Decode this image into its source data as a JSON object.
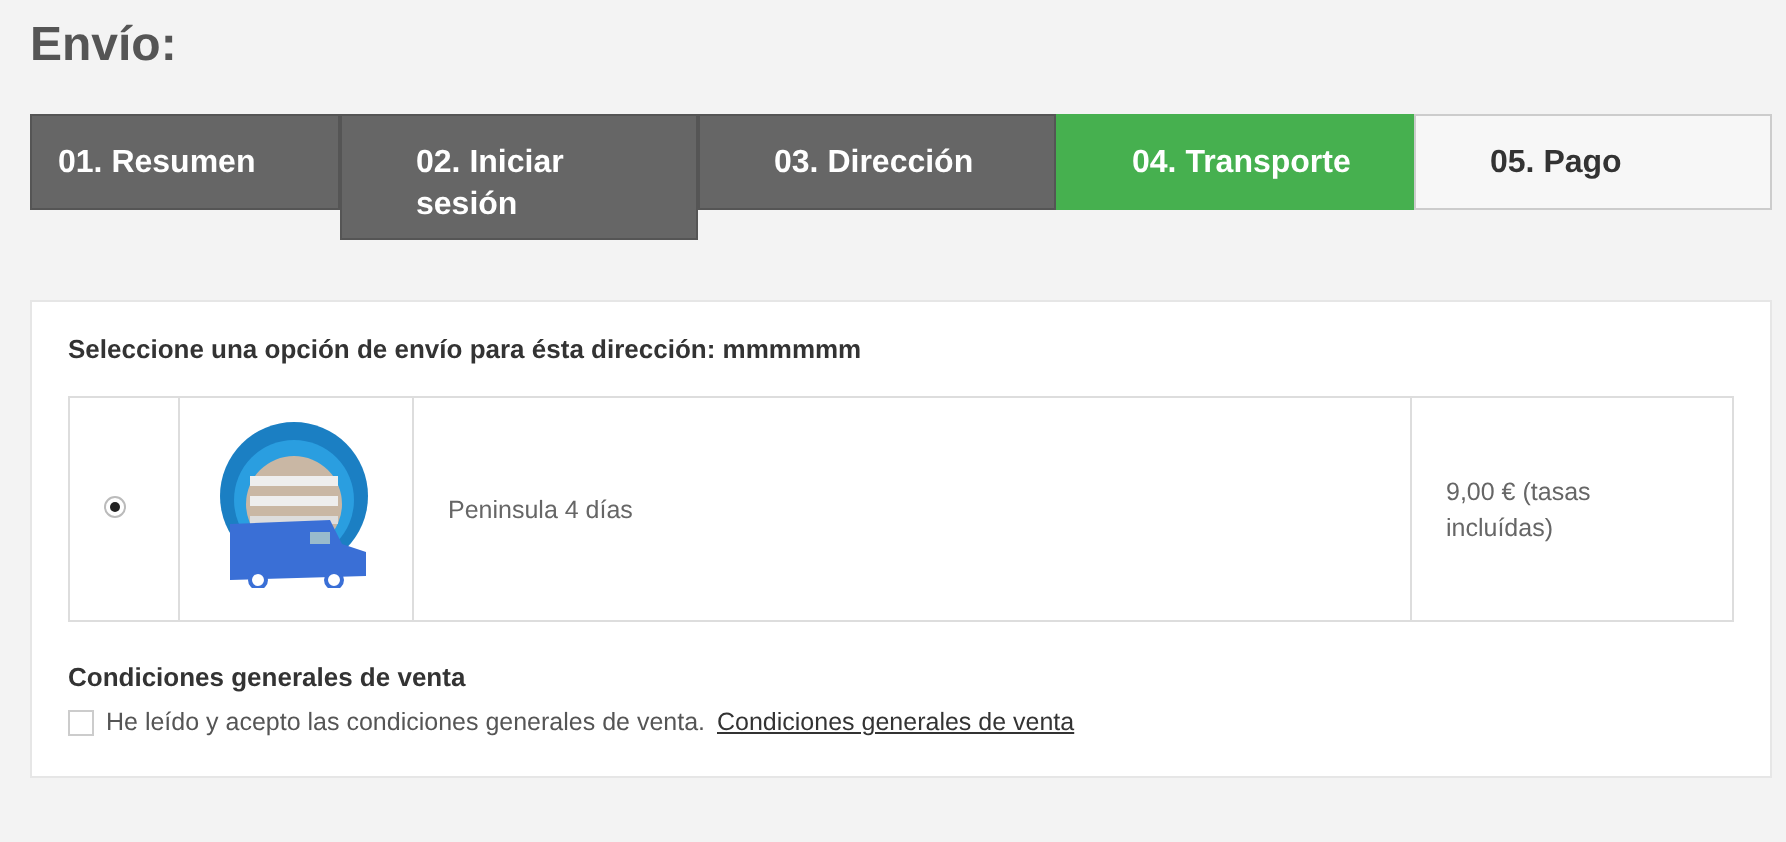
{
  "page_title": "Envío:",
  "steps": [
    {
      "label": "01. Resumen",
      "kind": "done",
      "selected": false
    },
    {
      "label": "02. Iniciar sesión",
      "kind": "done",
      "selected": false
    },
    {
      "label": "03. Dirección",
      "kind": "done",
      "selected": false
    },
    {
      "label": "04. Transporte",
      "kind": "todo",
      "selected": true
    },
    {
      "label": "05. Pago",
      "kind": "todo",
      "selected": false
    }
  ],
  "shipping": {
    "heading": "Seleccione una opción de envío para ésta dirección: mmmmmm",
    "options": [
      {
        "selected": true,
        "name": "Peninsula 4 días",
        "price": "9,00 € (tasas incluídas)"
      }
    ]
  },
  "terms": {
    "heading": "Condiciones generales de venta",
    "checked": false,
    "text": "He leído y acepto las condiciones generales de venta.",
    "link": "Condiciones generales de venta"
  }
}
